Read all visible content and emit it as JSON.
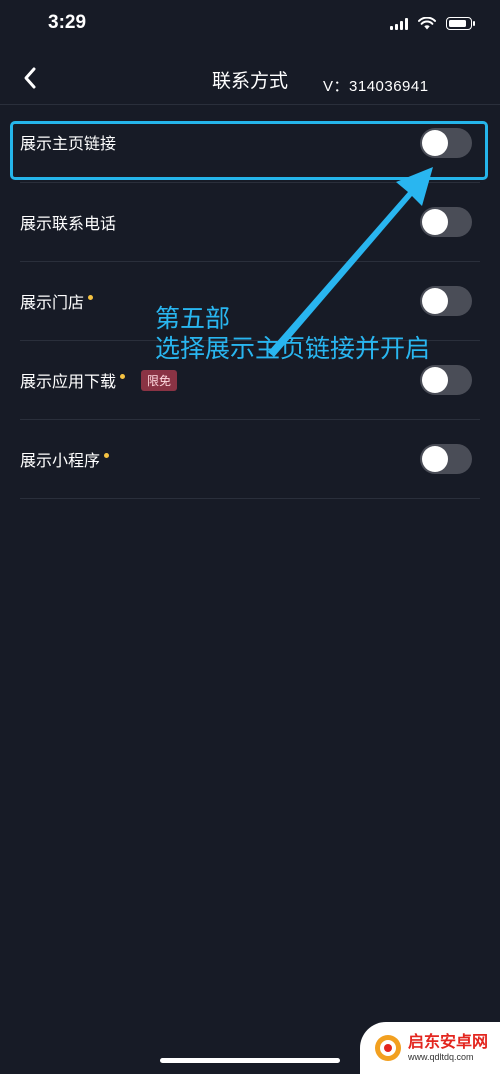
{
  "status_bar": {
    "time": "3:29",
    "icons": [
      "signal-icon",
      "wifi-icon",
      "battery-icon"
    ]
  },
  "nav": {
    "back_icon": "chevron-left-icon",
    "title": "联系方式",
    "id_text": "V：314036941"
  },
  "settings": {
    "items": [
      {
        "label": "展示主页链接",
        "has_dot": false,
        "badge": "",
        "enabled": false
      },
      {
        "label": "展示联系电话",
        "has_dot": false,
        "badge": "",
        "enabled": false
      },
      {
        "label": "展示门店",
        "has_dot": true,
        "badge": "",
        "enabled": false
      },
      {
        "label": "展示应用下载",
        "has_dot": true,
        "badge": "限免",
        "enabled": false
      },
      {
        "label": "展示小程序",
        "has_dot": true,
        "badge": "",
        "enabled": false
      }
    ]
  },
  "annotation": {
    "line1": "第五部",
    "line2": "选择展示主页链接并开启",
    "color": "#29b6f0"
  },
  "watermark": {
    "title": "启东安卓网",
    "url": "www.qdltdq.com"
  },
  "colors": {
    "background": "#171b26",
    "highlight": "#25b5ea",
    "toggle_off": "#4a4d57",
    "dot": "#f5c242",
    "badge_bg": "#8a3344"
  }
}
